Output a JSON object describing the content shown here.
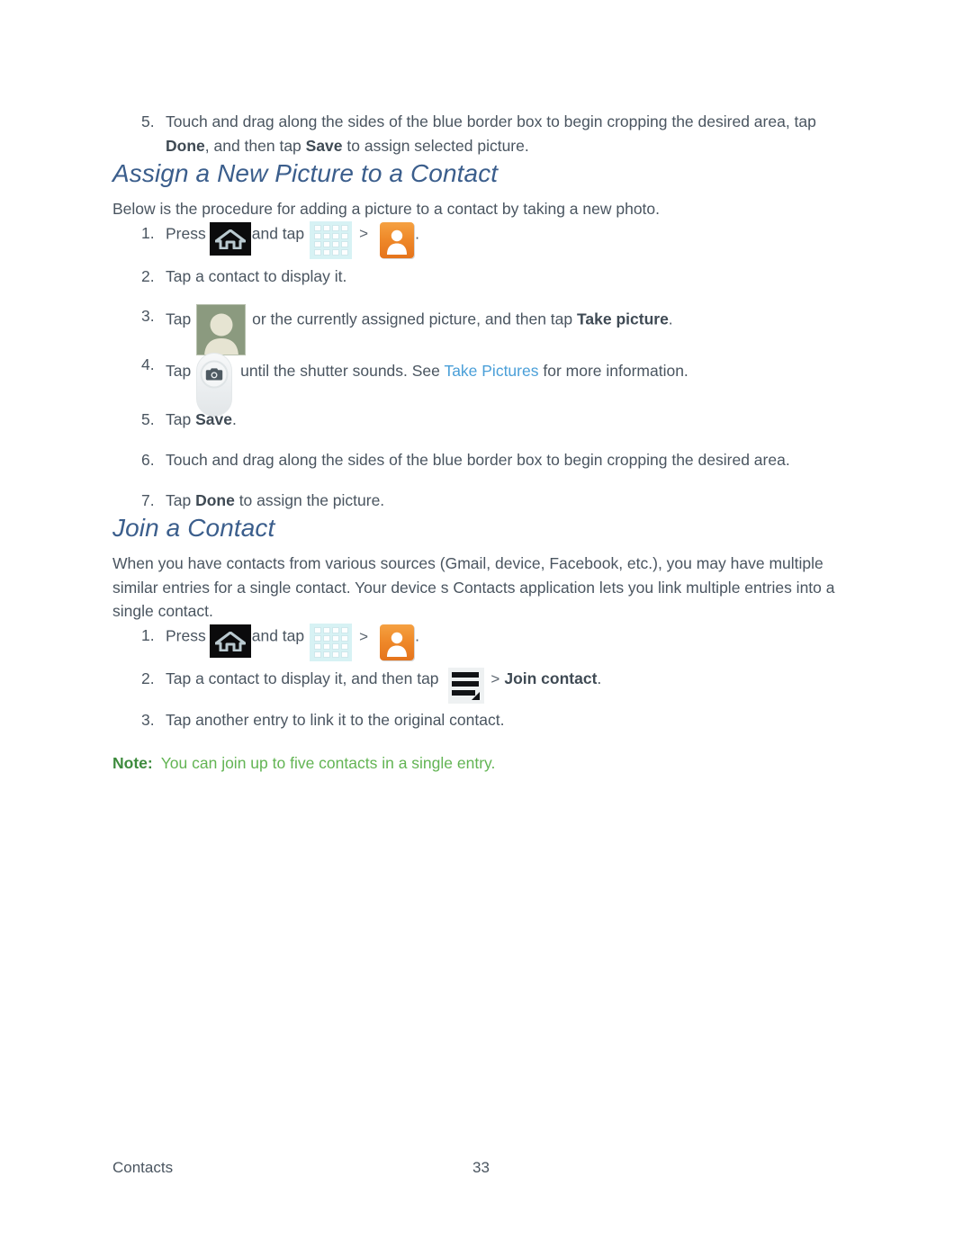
{
  "document": {
    "footer": {
      "label": "Contacts",
      "page_number": "33"
    }
  },
  "top_steps": {
    "items": [
      {
        "num": "5.",
        "text_1": "Touch and drag along the sides of the blue border box to begin cropping the desired area, tap ",
        "bold_1": "Done",
        "text_2": ", and then tap ",
        "bold_2": "Save",
        "text_3": " to assign selected picture."
      }
    ]
  },
  "assign_section": {
    "heading": "Assign a New Picture to a Contact",
    "intro": "Below is the procedure for adding a picture to a contact by taking a new photo.",
    "steps": {
      "s1": {
        "num": "1.",
        "press_label": "Press",
        "and_tap_label": "and tap",
        "chevron": ">",
        "period": ".",
        "icons": [
          "home-icon",
          "app-grid-icon",
          "contacts-app-icon"
        ]
      },
      "s2": {
        "num": "2.",
        "text": "Tap a contact to display it."
      },
      "s3": {
        "num": "3.",
        "tap_label": "Tap",
        "text_after": " or the currently assigned picture, and then tap ",
        "bold": "Take picture",
        "period": ".",
        "icon": "avatar-placeholder-icon"
      },
      "s4": {
        "num": "4.",
        "tap_label": "Tap",
        "text_after": " until the shutter sounds. See ",
        "link": "Take Pictures",
        "text_end": " for more information.",
        "icon": "camera-shutter-icon"
      },
      "s5": {
        "num": "5.",
        "text_1": "Tap ",
        "bold": "Save",
        "text_2": "."
      },
      "s6": {
        "num": "6.",
        "text": "Touch and drag along the sides of the blue border box to begin cropping the desired area."
      },
      "s7": {
        "num": "7.",
        "text_1": "Tap ",
        "bold": "Done",
        "text_2": " to assign the picture."
      }
    }
  },
  "join_section": {
    "heading": "Join a Contact",
    "intro": "When you have contacts from various sources (Gmail, device, Facebook, etc.), you may have multiple similar entries for a single contact. Your device s Contacts application lets you link multiple entries into a single contact.",
    "steps": {
      "s1": {
        "num": "1.",
        "press_label": "Press",
        "and_tap_label": "and tap",
        "chevron": ">",
        "period": ".",
        "icons": [
          "home-icon",
          "app-grid-icon",
          "contacts-app-icon"
        ]
      },
      "s2": {
        "num": "2.",
        "text_before": "Tap a contact to display it, and then tap ",
        "chevron": ">",
        "bold": "Join contact",
        "period": ".",
        "icon": "menu-icon"
      },
      "s3": {
        "num": "3.",
        "text": "Tap another entry to link it to the original contact."
      }
    },
    "note": {
      "label": "Note:",
      "text": "You can join up to five contacts in a single entry."
    }
  },
  "colors": {
    "heading": "#3b5e8c",
    "body": "#4a5560",
    "link": "#4a9fd8",
    "note_label": "#3d8b3d",
    "note_text": "#62b453",
    "contacts_icon_orange": "#ef8a2a",
    "avatar_green": "#8b9a7f"
  }
}
